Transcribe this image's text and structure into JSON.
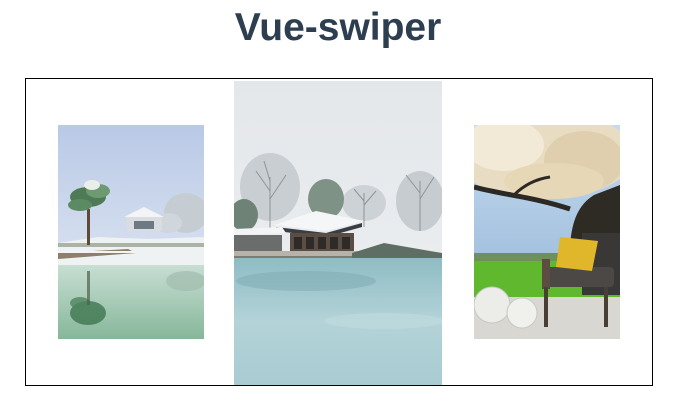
{
  "header": {
    "title": "Vue-swiper"
  },
  "swiper": {
    "slides": [
      {
        "subject": "snowy-lakeside-pine-tree-photo",
        "active": false
      },
      {
        "subject": "snowy-pavilion-on-lake-photo",
        "active": true
      },
      {
        "subject": "blossom-tree-armchair-on-lawn-photo",
        "active": false
      }
    ]
  },
  "colors": {
    "title": "#2c3e50",
    "frame_border": "#000000",
    "background": "#ffffff"
  }
}
